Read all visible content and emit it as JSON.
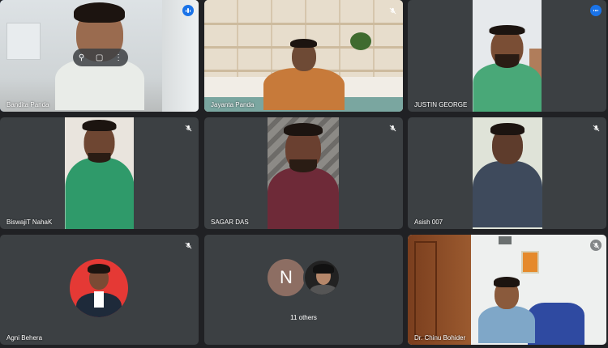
{
  "participants": [
    {
      "name": "Bandita Panda",
      "status": "speaking"
    },
    {
      "name": "Jayanta Panda",
      "status": "muted"
    },
    {
      "name": "JUSTIN GEORGE",
      "status": "speaking"
    },
    {
      "name": "BiswajiT NahaK",
      "status": "muted"
    },
    {
      "name": "SAGAR DAS",
      "status": "muted"
    },
    {
      "name": "Asish 007",
      "status": "muted"
    },
    {
      "name": "Agni Behera",
      "status": "muted"
    },
    {
      "name": "Dr. Chinu Bohider",
      "status": "muted"
    }
  ],
  "others": {
    "avatar_letter": "N",
    "label": "11 others"
  },
  "colors": {
    "background": "#202124",
    "tile": "#3c4043",
    "speaking": "#1a73e8",
    "active_border": "#8ab4f8"
  }
}
